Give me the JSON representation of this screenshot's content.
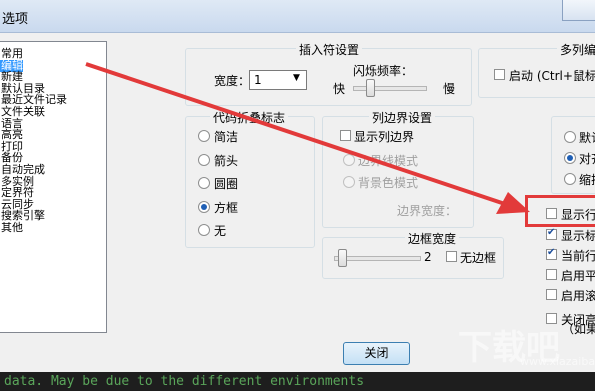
{
  "window": {
    "title": "选项"
  },
  "sidebar": {
    "items": [
      "常用",
      "编辑",
      "新建",
      "默认目录",
      "最近文件记录",
      "文件关联",
      "语言",
      "高亮",
      "打印",
      "备份",
      "自动完成",
      "多实例",
      "定界符",
      "云同步",
      "搜索引擎",
      "其他"
    ],
    "selected_index": 1
  },
  "insert_group": {
    "title": "插入符设置",
    "width_label": "宽度：",
    "width_value": "1",
    "blink_label": "闪烁频率：",
    "fast": "快",
    "slow": "慢"
  },
  "multicol_group": {
    "title": "多列编辑",
    "enable_label": "启动 (Ctrl+鼠标点"
  },
  "fold_group": {
    "title": "代码折叠标志",
    "options": [
      "简洁",
      "箭头",
      "圆圈",
      "方框",
      "无"
    ],
    "selected_index": 3
  },
  "colborder_group": {
    "title": "列边界设置",
    "show_label": "显示列边界",
    "line_mode": "边界线模式",
    "bg_mode": "背景色模式",
    "width_label": "边界宽度："
  },
  "border_group": {
    "title": "边框宽度",
    "value": "2",
    "no_border_label": "无边框"
  },
  "right_group": {
    "radios": [
      "默认",
      "对齐",
      "缩排"
    ],
    "selected_index": 1
  },
  "right_checks": [
    {
      "label": "显示行",
      "checked": false
    },
    {
      "label": "显示标",
      "checked": true
    },
    {
      "label": "当前行",
      "checked": true
    },
    {
      "label": "启用平",
      "checked": false
    },
    {
      "label": "启用滚",
      "checked": false
    },
    {
      "label": "关闭高",
      "checked": false
    }
  ],
  "right_check_note": "（如果",
  "buttons": {
    "close": "关闭"
  },
  "console": {
    "text": "data. May be due to the different environments"
  },
  "watermark": {
    "text": "下载吧",
    "sub": "www.xiazaiba.com"
  },
  "colors": {
    "selection": "#3399ff",
    "annotation": "#e23a3a",
    "console_text": "#5aa55a"
  }
}
